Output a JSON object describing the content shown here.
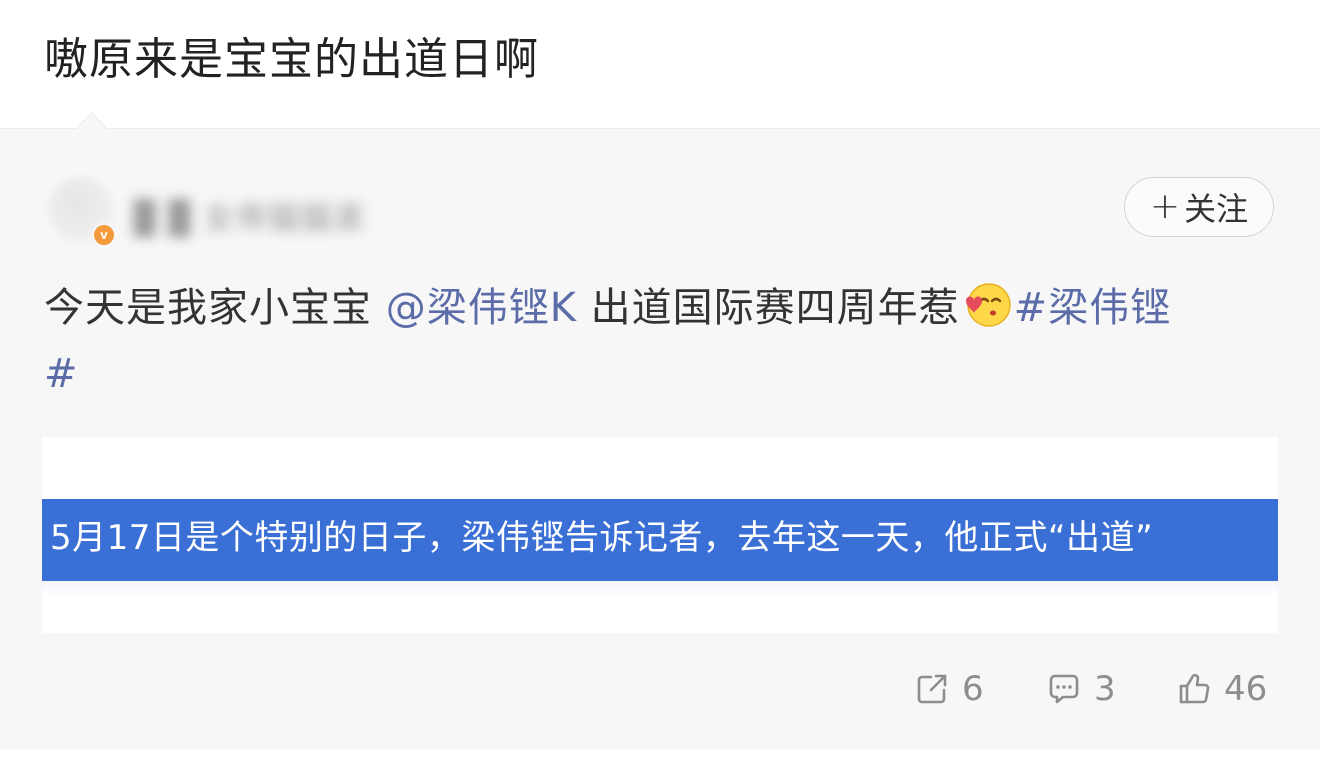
{
  "comment": {
    "text": "嗷原来是宝宝的出道日啊"
  },
  "quoted_post": {
    "author": {
      "name": "▉ ▉ 女帝猫猫滚",
      "verified_badge": "v"
    },
    "follow_label": "关注",
    "content": {
      "text_before": "今天是我家小宝宝 ",
      "mention": "@梁伟铿K",
      "text_middle": " 出道国际赛四周年惹",
      "hashtag_part1": "#梁伟铿",
      "hashtag_part2": "#"
    },
    "image": {
      "band_text": "5月17日是个特别的日子，梁伟铿告诉记者，去年这一天，他正式“出道”"
    },
    "actions": {
      "repost_count": "6",
      "comment_count": "3",
      "like_count": "46"
    }
  },
  "colors": {
    "link": "#5b6ca8",
    "band_blue": "#3a6fd6",
    "badge_orange": "#f39a3c"
  },
  "icons": [
    "plus-icon",
    "kiss-emoji-icon",
    "repost-icon",
    "comment-icon",
    "like-icon",
    "verified-badge-icon"
  ]
}
